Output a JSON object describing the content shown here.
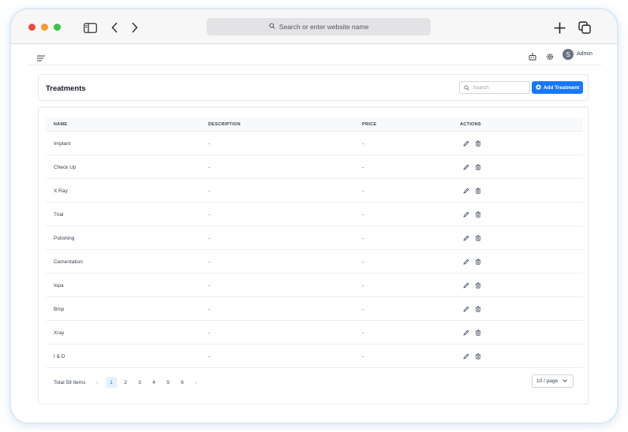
{
  "browser": {
    "url_placeholder": "Search or enter website name"
  },
  "appbar": {
    "user_initial": "S",
    "user_name": "Admin"
  },
  "page": {
    "title": "Treatments",
    "search_placeholder": "Search",
    "add_button_label": "Add Treatment"
  },
  "table": {
    "columns": [
      "NAME",
      "DESCRIPTION",
      "PRICE",
      "ACTIONS"
    ],
    "rows": [
      {
        "name": "Implant",
        "description": "-",
        "price": "-"
      },
      {
        "name": "Check Up",
        "description": "-",
        "price": "-"
      },
      {
        "name": "X Ray",
        "description": "-",
        "price": "-"
      },
      {
        "name": "Trial",
        "description": "-",
        "price": "-"
      },
      {
        "name": "Polishing",
        "description": "-",
        "price": "-"
      },
      {
        "name": "Cementation",
        "description": "-",
        "price": "-"
      },
      {
        "name": "Iopa",
        "description": "-",
        "price": "-"
      },
      {
        "name": "Bmp",
        "description": "-",
        "price": "-"
      },
      {
        "name": "Xray",
        "description": "-",
        "price": "-"
      },
      {
        "name": "I & D",
        "description": "-",
        "price": "-"
      }
    ]
  },
  "pagination": {
    "total_label": "Total 59 Items",
    "prev": "‹",
    "next": "›",
    "pages": [
      "1",
      "2",
      "3",
      "4",
      "5",
      "6"
    ],
    "current_page": "1",
    "page_size_label": "10 / page"
  },
  "icons": {
    "sidebar": "sidebar-icon",
    "back": "chevron-left-icon",
    "forward": "chevron-right-icon",
    "new_tab": "plus-icon",
    "tabs": "tabs-icon",
    "menu": "menu-icon",
    "robot": "robot-icon",
    "settings": "gear-icon",
    "search": "search-icon",
    "add": "plus-circle-icon",
    "edit": "pencil-icon",
    "delete": "trash-icon",
    "chevron_down": "chevron-down-icon"
  },
  "colors": {
    "accent": "#1677ff",
    "traffic_red": "#ee4b3f",
    "traffic_yellow": "#f29d2d",
    "traffic_green": "#35c548"
  }
}
